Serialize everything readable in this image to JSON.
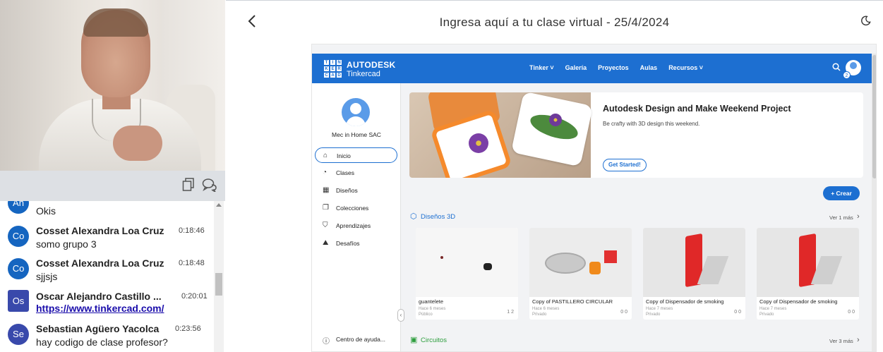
{
  "header": {
    "title": "Ingresa aquí a tu clase virtual - 25/4/2024"
  },
  "video_toolbar": {
    "icons": [
      "copy-icon",
      "chat-bubbles-icon"
    ]
  },
  "chat": {
    "messages": [
      {
        "initials": "An",
        "name": "",
        "time": "",
        "text": "Okis",
        "color": "#1565c0"
      },
      {
        "initials": "Co",
        "name": "Cosset Alexandra Loa Cruz",
        "time": "0:18:46",
        "text": "somo grupo 3",
        "color": "#1565c0"
      },
      {
        "initials": "Co",
        "name": "Cosset Alexandra Loa Cruz",
        "time": "0:18:48",
        "text": "sjjsjs",
        "color": "#1565c0"
      },
      {
        "initials": "Os",
        "name": "Oscar Alejandro Castillo ...",
        "time": "0:20:01",
        "text": "https://www.tinkercad.com/",
        "color": "#3949ab"
      },
      {
        "initials": "Se",
        "name": "Sebastian Agüero Yacolca",
        "time": "0:23:56",
        "text": "hay codigo de clase profesor?",
        "color": "#3949ab"
      }
    ]
  },
  "tinkercad": {
    "brand_line1": "AUTODESK",
    "brand_line2": "Tinkercad",
    "logo_letters": [
      "TIN",
      "KER",
      "CAD"
    ],
    "nav": [
      "Tinker ˅",
      "Galería",
      "Proyectos",
      "Aulas",
      "Recursos ˅"
    ],
    "user_badge": "2",
    "sidebar": {
      "name": "Mec in Home SAC",
      "items": [
        "Inicio",
        "Clases",
        "Diseños",
        "Colecciones",
        "Aprendizajes",
        "Desafíos"
      ],
      "help": "Centro de ayuda..."
    },
    "hero": {
      "title": "Autodesk Design and Make Weekend Project",
      "subtitle": "Be crafty with 3D design this weekend.",
      "button": "Get Started!"
    },
    "crear": "+ Crear",
    "section_3d": {
      "title": "Diseños 3D",
      "more": "Ver 1 más"
    },
    "section_circuits": {
      "title": "Circuitos",
      "more": "Ver 3 más"
    },
    "cards": [
      {
        "name": "guantelete",
        "time": "Hace 6 meses",
        "visibility": "Público",
        "stats": "1  2"
      },
      {
        "name": "Copy of PASTILLERO CIRCULAR",
        "time": "Hace 6 meses",
        "visibility": "Privado",
        "stats": "0  0"
      },
      {
        "name": "Copy of Dispensador de smoking",
        "time": "Hace 7 meses",
        "visibility": "Privado",
        "stats": "0  0"
      },
      {
        "name": "Copy of Dispensador de smoking",
        "time": "Hace 7 meses",
        "visibility": "Privado",
        "stats": "0  0"
      }
    ]
  }
}
